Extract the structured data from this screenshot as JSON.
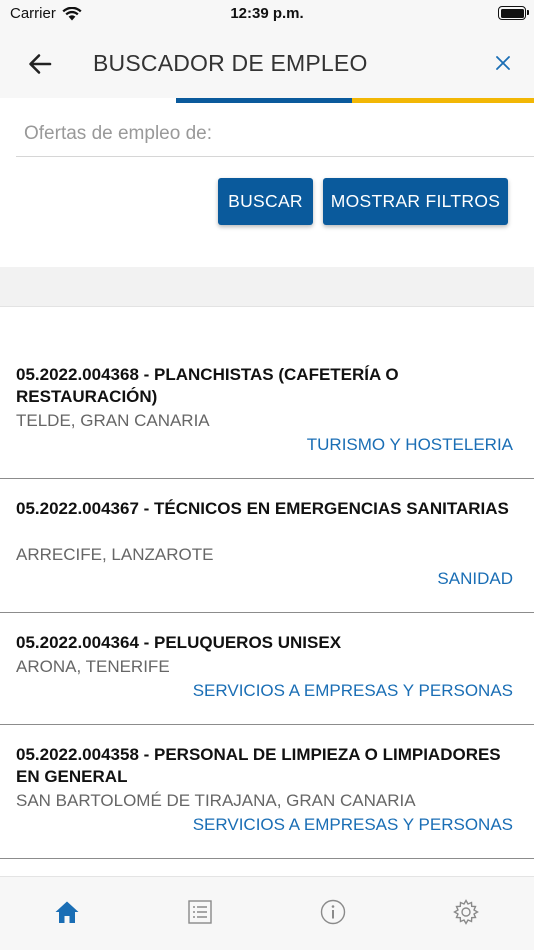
{
  "status": {
    "carrier": "Carrier",
    "time": "12:39 p.m."
  },
  "nav": {
    "title": "BUSCADOR DE EMPLEO"
  },
  "search": {
    "placeholder": "Ofertas de empleo de:",
    "value": "",
    "search_label": "BUSCAR",
    "filters_label": "MOSTRAR FILTROS"
  },
  "colors": {
    "primary": "#0a5a9c",
    "accent": "#f2b705",
    "link": "#1a6eb5"
  },
  "jobs": [
    {
      "title": "05.2022.004368 - PLANCHISTAS (CAFETERÍA O RESTAURACIÓN)",
      "location": "TELDE, GRAN CANARIA",
      "category": "TURISMO Y HOSTELERIA"
    },
    {
      "title": "05.2022.004367 - TÉCNICOS EN EMERGENCIAS SANITARIAS",
      "location": "ARRECIFE, LANZAROTE",
      "category": "SANIDAD"
    },
    {
      "title": "05.2022.004364 - PELUQUEROS UNISEX",
      "location": "ARONA, TENERIFE",
      "category": "SERVICIOS A EMPRESAS Y PERSONAS"
    },
    {
      "title": "05.2022.004358 - PERSONAL DE LIMPIEZA O LIMPIADORES EN GENERAL",
      "location": "SAN BARTOLOMÉ DE TIRAJANA, GRAN CANARIA",
      "category": "SERVICIOS A EMPRESAS Y PERSONAS"
    }
  ],
  "tabs": [
    {
      "icon": "home-icon",
      "active": true
    },
    {
      "icon": "list-icon",
      "active": false
    },
    {
      "icon": "info-icon",
      "active": false
    },
    {
      "icon": "gear-icon",
      "active": false
    }
  ]
}
